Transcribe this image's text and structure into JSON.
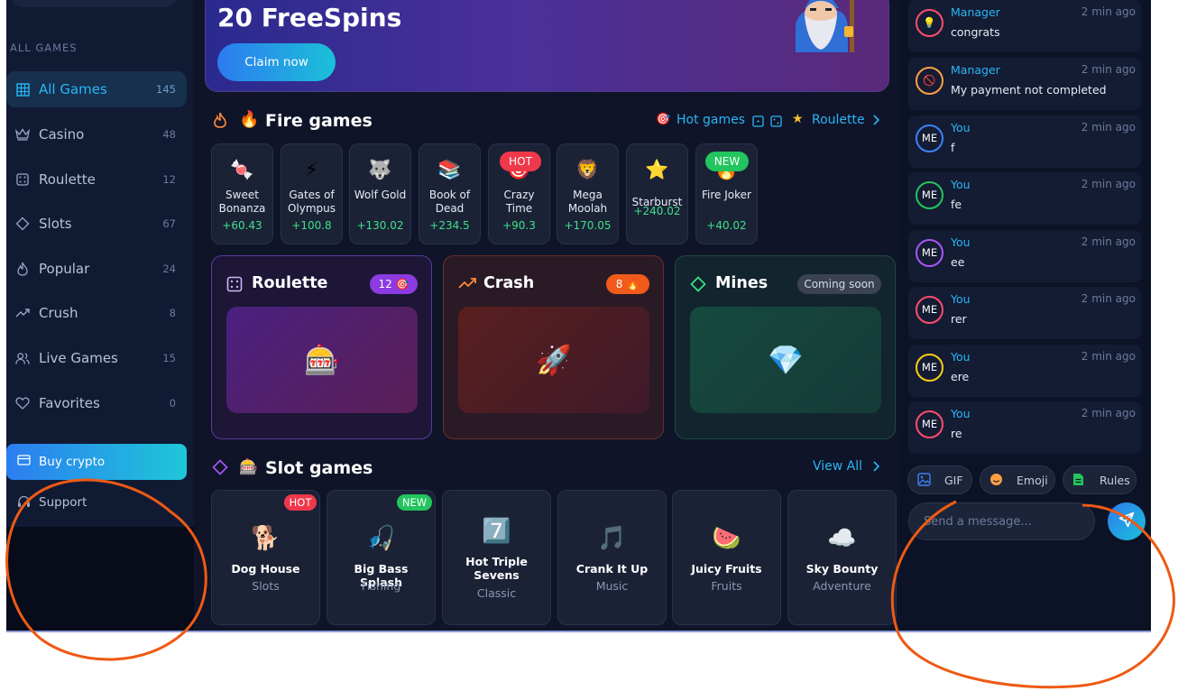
{
  "sidebar": {
    "section_label": "ALL GAMES",
    "items": [
      {
        "label": "All Games",
        "count": "145",
        "icon": "grid-icon"
      },
      {
        "label": "Casino",
        "count": "48",
        "icon": "crown-icon"
      },
      {
        "label": "Roulette",
        "count": "12",
        "icon": "dice-icon"
      },
      {
        "label": "Slots",
        "count": "67",
        "icon": "diamond-icon"
      },
      {
        "label": "Popular",
        "count": "24",
        "icon": "flame-icon"
      },
      {
        "label": "Crush",
        "count": "8",
        "icon": "trend-up-icon"
      },
      {
        "label": "Live Games",
        "count": "15",
        "icon": "users-icon"
      },
      {
        "label": "Favorites",
        "count": "0",
        "icon": "heart-icon"
      }
    ],
    "buy_crypto": "Buy crypto",
    "support": "Support"
  },
  "hero": {
    "title": "20 FreeSpins",
    "button": "Claim now"
  },
  "fire_games": {
    "title": "Fire games",
    "title_emoji": "🔥",
    "hot_games_link": "Hot games",
    "roulette_link": "Roulette",
    "cards": [
      {
        "emoji": "🍬",
        "name": "Sweet Bonanza",
        "gain": "+60.43",
        "tag": ""
      },
      {
        "emoji": "⚡",
        "name": "Gates of Olympus",
        "gain": "+100.8",
        "tag": ""
      },
      {
        "emoji": "🐺",
        "name": "Wolf Gold",
        "gain": "+130.02",
        "tag": ""
      },
      {
        "emoji": "📚",
        "name": "Book of Dead",
        "gain": "+234.5",
        "tag": ""
      },
      {
        "emoji": "🎯",
        "name": "Crazy Time",
        "gain": "+90.3",
        "tag": "HOT"
      },
      {
        "emoji": "🦁",
        "name": "Mega Moolah",
        "gain": "+170.05",
        "tag": ""
      },
      {
        "emoji": "⭐",
        "name": "Starburst",
        "gain": "+240.02",
        "tag": ""
      },
      {
        "emoji": "🔥",
        "name": "Fire Joker",
        "gain": "+40.02",
        "tag": "NEW"
      }
    ]
  },
  "big_cards": {
    "roulette": {
      "title": "Roulette",
      "badge": "12 🎯",
      "emoji": "🎰"
    },
    "crash": {
      "title": "Crash",
      "badge": "8 🔥",
      "emoji": "🚀"
    },
    "mines": {
      "title": "Mines",
      "badge": "Coming soon",
      "emoji": "💎"
    }
  },
  "slot_games": {
    "title": "Slot games",
    "title_emoji": "🎰",
    "view_all": "View All",
    "cards": [
      {
        "emoji": "🐕",
        "name": "Dog House",
        "category": "Slots",
        "tag": "HOT"
      },
      {
        "emoji": "🎣",
        "name": "Big Bass Splash",
        "category": "Fishing",
        "tag": "NEW"
      },
      {
        "emoji": "7️⃣",
        "name": "Hot Triple Sevens",
        "category": "Classic",
        "tag": ""
      },
      {
        "emoji": "🎵",
        "name": "Crank It Up",
        "category": "Music",
        "tag": ""
      },
      {
        "emoji": "🍉",
        "name": "Juicy Fruits",
        "category": "Fruits",
        "tag": ""
      },
      {
        "emoji": "☁️",
        "name": "Sky Bounty",
        "category": "Adventure",
        "tag": ""
      }
    ]
  },
  "chat": {
    "messages": [
      {
        "avatar": "💡",
        "user": "Manager",
        "time": "2 min ago",
        "text": "congrats",
        "ring": "#ff4d6d"
      },
      {
        "avatar": "🚫",
        "user": "Manager",
        "time": "2 min ago",
        "text": "My payment not completed",
        "ring": "#ff9f43"
      },
      {
        "avatar": "ME",
        "user": "You",
        "time": "2 min ago",
        "text": "f",
        "ring": "#3b82f6"
      },
      {
        "avatar": "ME",
        "user": "You",
        "time": "2 min ago",
        "text": "fe",
        "ring": "#22c55e"
      },
      {
        "avatar": "ME",
        "user": "You",
        "time": "2 min ago",
        "text": "ee",
        "ring": "#a855f7"
      },
      {
        "avatar": "ME",
        "user": "You",
        "time": "2 min ago",
        "text": "rer",
        "ring": "#ff4d6d"
      },
      {
        "avatar": "ME",
        "user": "You",
        "time": "2 min ago",
        "text": "ere",
        "ring": "#facc15"
      },
      {
        "avatar": "ME",
        "user": "You",
        "time": "2 min ago",
        "text": "re",
        "ring": "#ff4d6d"
      }
    ],
    "gif": "GIF",
    "emoji": "Emoji",
    "rules": "Rules",
    "input_placeholder": "Send a message..."
  }
}
